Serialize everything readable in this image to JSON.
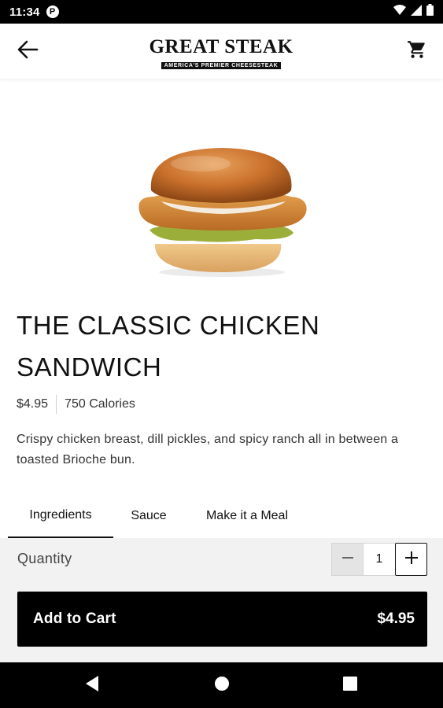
{
  "status_bar": {
    "time": "11:34",
    "app_icon": "P",
    "icons": [
      "wifi-icon",
      "signal-icon",
      "battery-icon"
    ]
  },
  "header": {
    "back_icon": "arrow-left-icon",
    "brand_name": "GREAT STEAK",
    "brand_tagline": "AMERICA'S PREMIER CHEESESTEAK",
    "cart_icon": "cart-icon"
  },
  "product": {
    "title": "THE CLASSIC CHICKEN SANDWICH",
    "price": "$4.95",
    "calories": "750 Calories",
    "description": "Crispy chicken breast, dill pickles, and spicy ranch all in between a toasted Brioche bun."
  },
  "tabs": [
    {
      "label": "Ingredients",
      "active": true
    },
    {
      "label": "Sauce",
      "active": false
    },
    {
      "label": "Make it a Meal",
      "active": false
    }
  ],
  "order": {
    "quantity_label": "Quantity",
    "quantity": "1",
    "add_to_cart_label": "Add to Cart",
    "total": "$4.95"
  },
  "nav_bar": {
    "icons": [
      "nav-back-icon",
      "nav-home-icon",
      "nav-recents-icon"
    ]
  },
  "colors": {
    "primary": "#000000",
    "panel_bg": "#f2f2f2",
    "text": "#111111"
  }
}
